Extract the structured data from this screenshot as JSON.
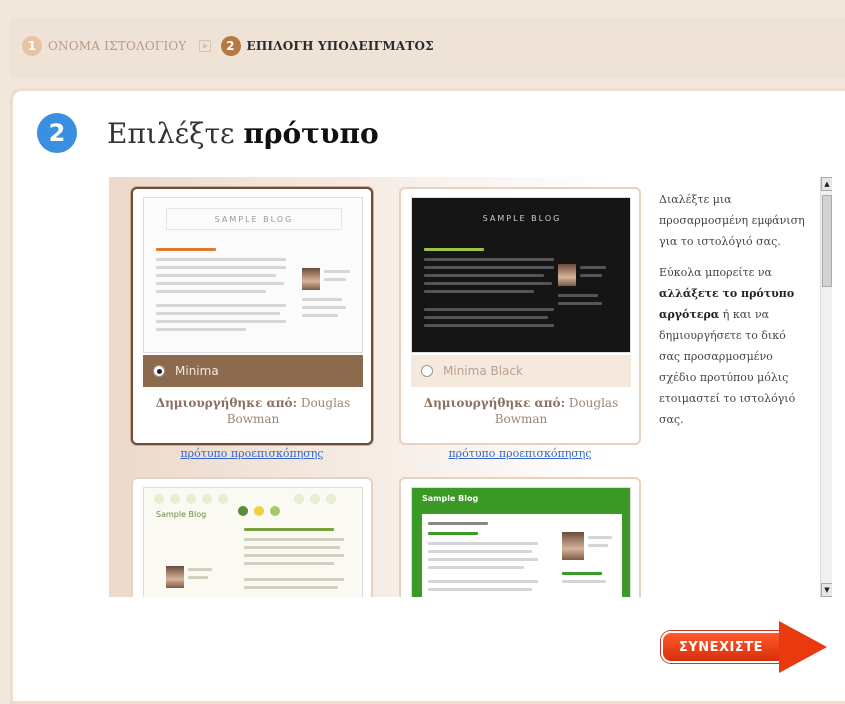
{
  "wizard": {
    "step1_num": "1",
    "step1_label": "ΟΝΟΜΑ ΙΣΤΟΛΟΓΙΟΥ",
    "step2_num": "2",
    "step2_label": "ΕΠΙΛΟΓΗ ΥΠΟΔΕΙΓΜΑΤΟΣ"
  },
  "page": {
    "step_num": "2",
    "title_regular": "Επιλέξτε ",
    "title_bold": "πρότυπο"
  },
  "templates": [
    {
      "name": "Minima",
      "author_prefix": "Δημιουργήθηκε από:",
      "author": "Douglas Bowman",
      "preview_link": "πρότυπο προεπισκόπησης",
      "blog_label": "SAMPLE BLOG"
    },
    {
      "name": "Minima Black",
      "author_prefix": "Δημιουργήθηκε από:",
      "author": "Douglas Bowman",
      "preview_link": "πρότυπο προεπισκόπησης",
      "blog_label": "SAMPLE BLOG"
    },
    {
      "blog_label": "Sample Blog"
    },
    {
      "blog_label": "Sample Blog"
    }
  ],
  "description": {
    "para1": "Διαλέξτε μια προσαρμοσμένη εμφάνιση για το ιστολόγιό σας.",
    "para2_a": "Εύκολα μπορείτε να ",
    "para2_bold": "αλλάξετε το πρότυπο αργότερα",
    "para2_b": " ή και να δημιουργήσετε το δικό σας προσαρμοσμένο σχέδιο προτύπου μόλις ετοιμαστεί το ιστολόγιό σας."
  },
  "continue_label": "ΣΥΝΕΧΙΣΤΕ",
  "colors": {
    "accent_blue": "#3b8fe0",
    "selected_bar": "#8b6a4e",
    "continue": "#e8390f"
  }
}
